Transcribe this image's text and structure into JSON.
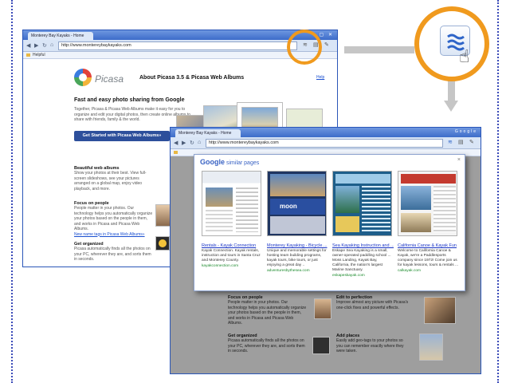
{
  "back_browser": {
    "tab_title": "Monterey Bay Kayaks - Home",
    "url": "http://www.montereybaykayaks.com",
    "bookmark": "Helpful",
    "brand": "Picasa",
    "about_title": "About Picasa 3.5 & Picasa Web Albums",
    "help_link": "Help",
    "tagline": "Fast and easy photo sharing from Google",
    "description": "Together, Picasa & Picasa Web Albums make it easy for you to organize and edit your digital photos, then create online albums to share with friends, family & the world.",
    "cta_button": "Get Started with Picasa Web Albums»",
    "sections": [
      {
        "heading": "Beautiful web albums",
        "text": "Show your photos at their best. View full-screen slideshows, see your pictures arranged on a global map, enjoy video playback, and more."
      },
      {
        "heading": "Focus on people",
        "text": "People matter in your photos. Our technology helps you automatically organize your photos based on the people in them, and works in Picasa and Picasa Web Albums.",
        "link": "New name tags in Picasa Web Albums»"
      },
      {
        "heading": "Get organized",
        "text": "Picasa automatically finds all the photos on your PC, wherever they are, and sorts them in seconds."
      }
    ]
  },
  "front_browser": {
    "tab_title": "Monterey Bay Kayaks - Home",
    "url": "http://www.montereybaykayaks.com",
    "top_right": "Google",
    "bottom_sections": [
      {
        "heading": "Focus on people",
        "text": "People matter in your photos. Our technology helps you automatically organize your photos based on the people in them, and works in Picasa and Picasa Web Albums."
      },
      {
        "heading": "Get organized",
        "text": "Picasa automatically finds all the photos on your PC, wherever they are, and sorts them in seconds."
      },
      {
        "heading": "Edit to perfection",
        "text": "Improve almost any picture with Picasa's one-click fixes and powerful effects."
      },
      {
        "heading": "Add places",
        "text": "Easily add geo-tags to your photos so you can remember exactly where they were taken."
      }
    ]
  },
  "popup": {
    "brand": "Google",
    "subtitle": "similar pages",
    "close": "×",
    "results": [
      {
        "title": "Rentals - Kayak Connection",
        "desc": "Kayak Connection. Kayak rentals, instruction and tours in Santa Cruz and Monterey County.",
        "url": "kayakconnection.com"
      },
      {
        "title": "Monterey Kayaking - Bicycle ...",
        "desc": "Unique and memorable settings for hosting team building programs, kayak tours, bike tours, or just enjoying a great day ..",
        "url": "adventuresbythesea.com"
      },
      {
        "title": "Sea Kayaking Instruction and ...",
        "desc": "Eskape Sea Kayaking is a small, owner-operated paddling school ... Moss Landing, Kayak Bay, California, the nation's largest Marine Sanctuary.",
        "url": "eskapeskayak.com"
      },
      {
        "title": "California Canoe & Kayak Fun",
        "desc": "Welcome to California Canoe & Kayak, we're a Paddlesports company since 1972! Come join us for kayak lessons, tours & rentals ...",
        "url": "calkayak.com"
      }
    ]
  },
  "colors": {
    "callout_ring": "#f09a1e",
    "connector": "#c6c6c6",
    "titlebar": "#3d6cc9",
    "link": "#1a35c6",
    "url_green": "#1b8a2c"
  },
  "icons": {
    "extension": "similar-pages-icon",
    "cursor": "hand-pointer-icon"
  }
}
